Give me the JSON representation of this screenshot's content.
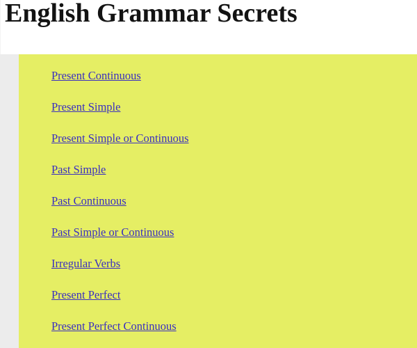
{
  "page": {
    "title": "English Grammar Secrets",
    "header_background": "#ffffff",
    "content_background": "#e5ee64",
    "gutter_background": "#ececec",
    "title_color": "#131313",
    "link_color": "#3a2fc0"
  },
  "links": [
    {
      "label": "Present Continuous"
    },
    {
      "label": "Present Simple"
    },
    {
      "label": "Present Simple or Continuous"
    },
    {
      "label": "Past Simple"
    },
    {
      "label": "Past Continuous"
    },
    {
      "label": "Past Simple or Continuous"
    },
    {
      "label": "Irregular Verbs"
    },
    {
      "label": "Present Perfect"
    },
    {
      "label": "Present Perfect Continuous"
    }
  ]
}
